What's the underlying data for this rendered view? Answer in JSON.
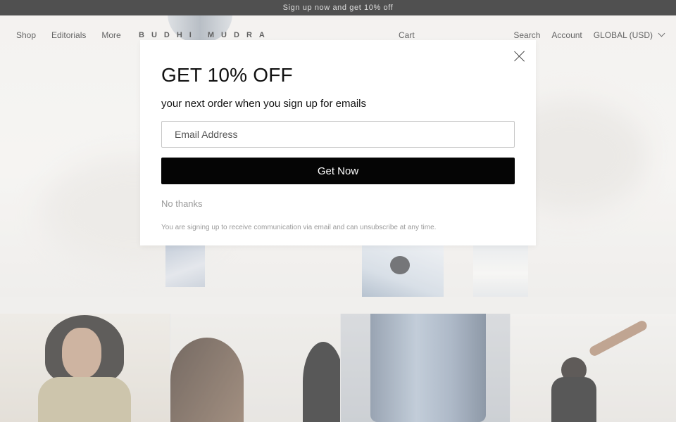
{
  "announcement": {
    "text": "Sign up now and get 10% off"
  },
  "header": {
    "nav_left": [
      "Shop",
      "Editorials",
      "More"
    ],
    "logo": "BUDHI MUDRA",
    "cart": "Cart",
    "search": "Search",
    "account": "Account",
    "currency": "GLOBAL (USD)"
  },
  "modal": {
    "title": "GET 10% OFF",
    "subtitle": "your next order when you sign up for emails",
    "email_placeholder": "Email Address",
    "email_value": "",
    "submit_label": "Get Now",
    "decline_label": "No thanks",
    "legal": "You are signing up to receive communication via email and can unsubscribe at any time."
  },
  "icons": {
    "close": "close-icon",
    "currency_chevron": "chevron-down-icon"
  },
  "colors": {
    "announcement_bg": "#050505",
    "button_bg": "#050505",
    "button_text": "#ffffff"
  }
}
